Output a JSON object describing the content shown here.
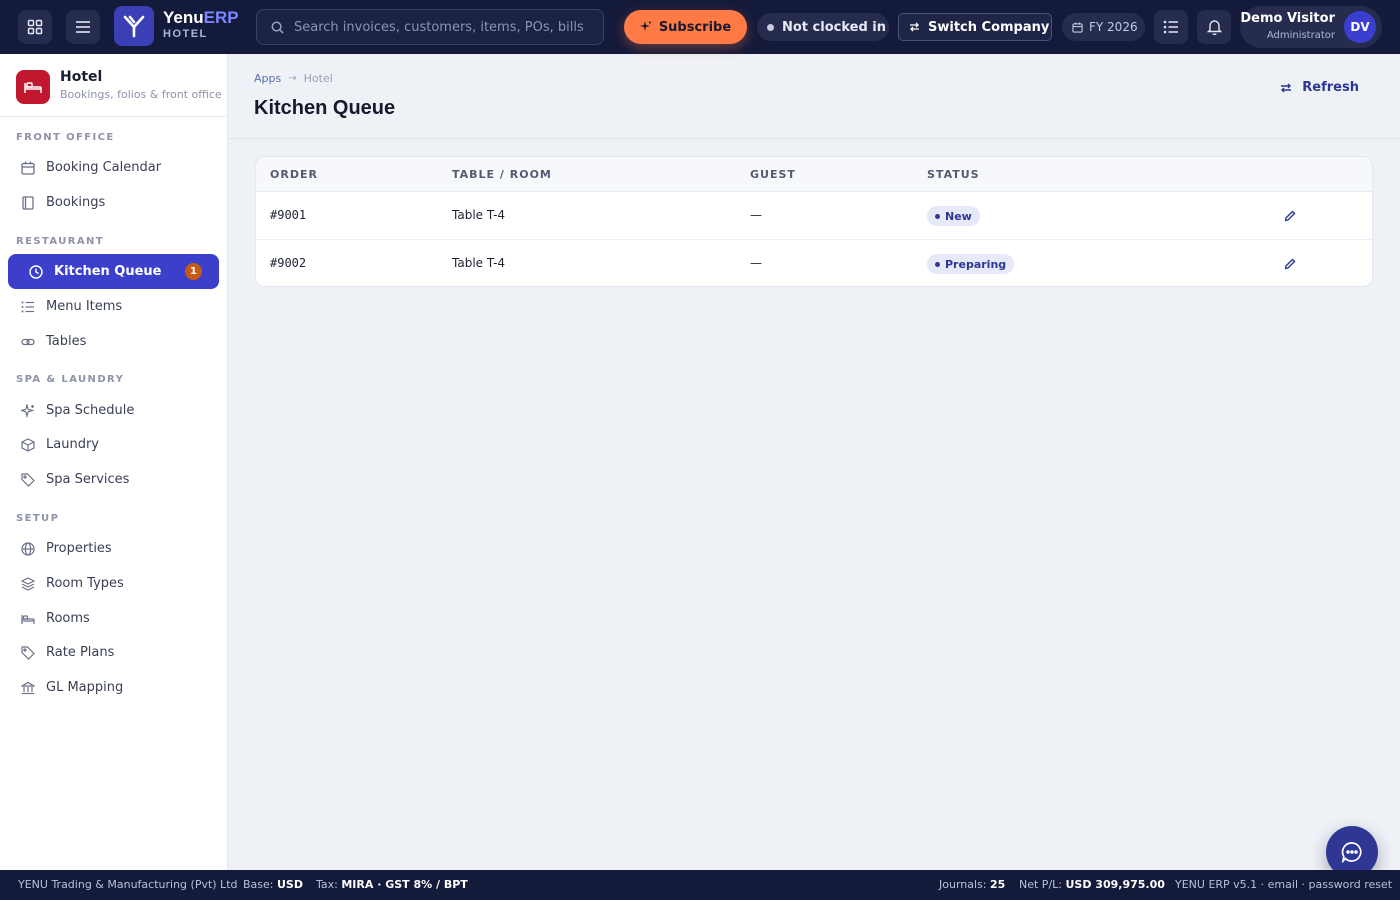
{
  "topbar": {
    "brand_main": "Yenu",
    "brand_accent": "ERP",
    "brand_sub": "HOTEL",
    "search_placeholder": "Search invoices, customers, items, POs, bills…",
    "subscribe_label": "Subscribe",
    "clock_status": "Not clocked in",
    "switch_company_label": "Switch Company",
    "fiscal_year": "FY 2026",
    "user_name": "Demo Visitor",
    "user_role": "Administrator",
    "user_initials": "DV"
  },
  "sidebar": {
    "app_title": "Hotel",
    "app_subtitle": "Bookings, folios & front office",
    "sections": [
      {
        "title": "FRONT OFFICE",
        "items": [
          {
            "label": "Booking Calendar",
            "icon": "calendar-icon"
          },
          {
            "label": "Bookings",
            "icon": "book-icon"
          }
        ]
      },
      {
        "title": "RESTAURANT",
        "items": [
          {
            "label": "Kitchen Queue",
            "icon": "clock-icon",
            "active": true,
            "badge": "1"
          },
          {
            "label": "Menu Items",
            "icon": "list-icon"
          },
          {
            "label": "Tables",
            "icon": "link-icon"
          }
        ]
      },
      {
        "title": "SPA & LAUNDRY",
        "items": [
          {
            "label": "Spa Schedule",
            "icon": "sparkle-icon"
          },
          {
            "label": "Laundry",
            "icon": "box-icon"
          },
          {
            "label": "Spa Services",
            "icon": "tag-icon"
          }
        ]
      },
      {
        "title": "SETUP",
        "items": [
          {
            "label": "Properties",
            "icon": "globe-icon"
          },
          {
            "label": "Room Types",
            "icon": "layers-icon"
          },
          {
            "label": "Rooms",
            "icon": "bed-icon"
          },
          {
            "label": "Rate Plans",
            "icon": "tag-icon"
          },
          {
            "label": "GL Mapping",
            "icon": "bank-icon"
          }
        ]
      }
    ]
  },
  "main": {
    "breadcrumb": [
      "Apps",
      "Hotel"
    ],
    "title": "Kitchen Queue",
    "refresh_label": "Refresh",
    "table": {
      "columns": [
        "ORDER",
        "TABLE / ROOM",
        "GUEST",
        "STATUS"
      ],
      "rows": [
        {
          "order": "#9001",
          "table": "Table T-4",
          "guest": "—",
          "status": "New"
        },
        {
          "order": "#9002",
          "table": "Table T-4",
          "guest": "—",
          "status": "Preparing"
        }
      ]
    }
  },
  "footer": {
    "company": "YENU Trading & Manufacturing (Pvt) Ltd",
    "base_label": "Base:",
    "base_value": "USD",
    "tax_label": "Tax:",
    "tax_value": "MIRA · GST 8% / BPT",
    "journals_label": "Journals:",
    "journals_value": "25",
    "netpl_label": "Net P/L:",
    "netpl_value": "USD 309,975.00",
    "version": "YENU ERP v5.1 · email · password reset"
  },
  "colors": {
    "topbar": "#141a3a",
    "accent": "#3b3fc9",
    "subscribe": "#ff7a45",
    "badge": "#c55a1a",
    "app_logo": "#c2182f"
  }
}
